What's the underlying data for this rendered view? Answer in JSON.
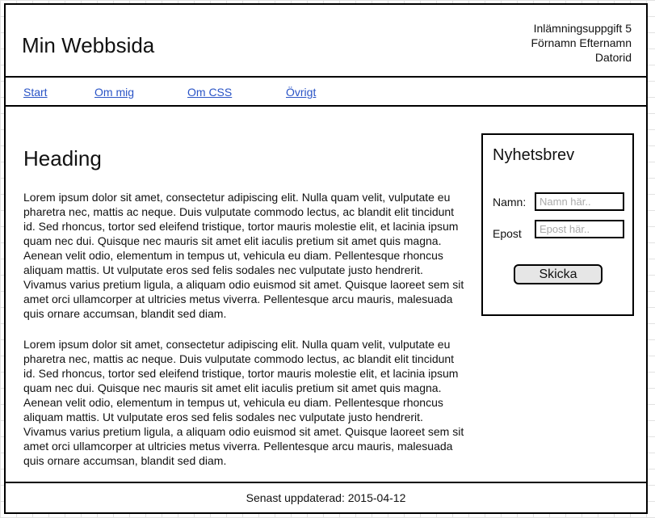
{
  "header": {
    "title": "Min Webbsida",
    "info_lines": [
      "Inlämningsuppgift 5",
      "Förnamn Efternamn",
      "Datorid"
    ]
  },
  "nav": {
    "items": [
      {
        "label": "Start"
      },
      {
        "label": "Om mig"
      },
      {
        "label": "Om CSS"
      },
      {
        "label": "Övrigt"
      }
    ]
  },
  "main": {
    "heading": "Heading",
    "paragraphs": [
      "Lorem ipsum dolor sit amet, consectetur adipiscing elit. Nulla quam velit, vulputate eu pharetra nec, mattis ac neque. Duis vulputate commodo lectus, ac blandit elit tincidunt id. Sed rhoncus, tortor sed eleifend tristique, tortor mauris molestie elit, et lacinia ipsum quam nec dui. Quisque nec mauris sit amet elit iaculis pretium sit amet quis magna. Aenean velit odio, elementum in tempus ut, vehicula eu diam. Pellentesque rhoncus aliquam mattis. Ut vulputate eros sed felis sodales nec vulputate justo hendrerit. Vivamus varius pretium ligula, a aliquam odio euismod sit amet. Quisque laoreet sem sit amet orci ullamcorper at ultricies metus viverra. Pellentesque arcu mauris, malesuada quis ornare accumsan, blandit sed diam.",
      "Lorem ipsum dolor sit amet, consectetur adipiscing elit. Nulla quam velit, vulputate eu pharetra nec, mattis ac neque. Duis vulputate commodo lectus, ac blandit elit tincidunt id. Sed rhoncus, tortor sed eleifend tristique, tortor mauris molestie elit, et lacinia ipsum quam nec dui. Quisque nec mauris sit amet elit iaculis pretium sit amet quis magna. Aenean velit odio, elementum in tempus ut, vehicula eu diam. Pellentesque rhoncus aliquam mattis. Ut vulputate eros sed felis sodales nec vulputate justo hendrerit. Vivamus varius pretium ligula, a aliquam odio euismod sit amet. Quisque laoreet sem sit amet orci ullamcorper at ultricies metus viverra. Pellentesque arcu mauris, malesuada quis ornare accumsan, blandit sed diam."
    ]
  },
  "newsletter": {
    "title": "Nyhetsbrev",
    "name_label": "Namn:",
    "name_placeholder": "Namn här..",
    "name_value": "",
    "email_label": "Epost",
    "email_placeholder": "Epost här..",
    "email_value": "",
    "submit_label": "Skicka"
  },
  "footer": {
    "text": "Senast uppdaterad: 2015-04-12"
  },
  "colors": {
    "link": "#2a54c6",
    "border": "#000000",
    "button_bg": "#e6e6e6",
    "grid": "#e2e2e2"
  }
}
